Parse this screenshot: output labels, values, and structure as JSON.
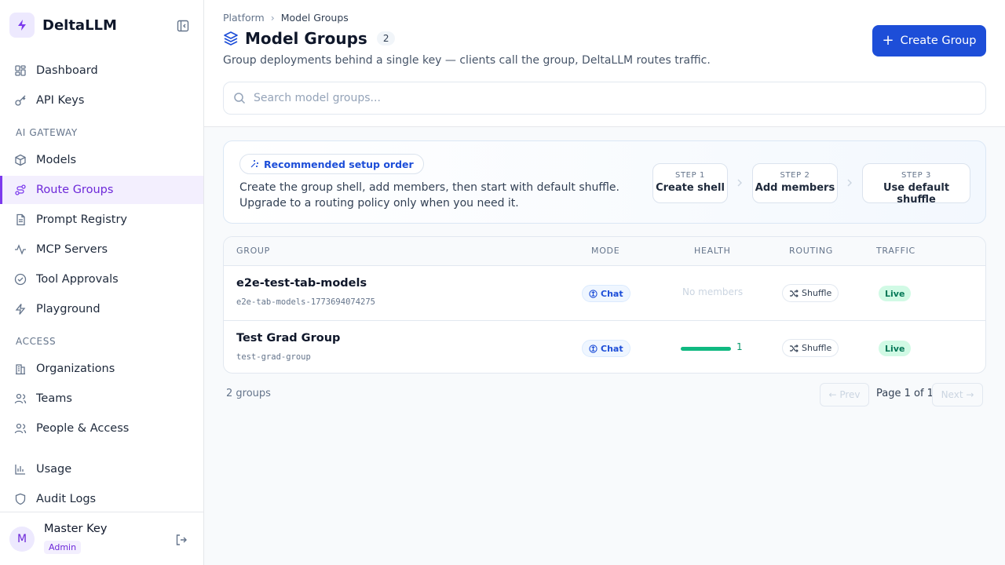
{
  "brand": {
    "name": "DeltaLLM",
    "accent": "#7c3aed"
  },
  "sidebar": {
    "items": [
      {
        "label": "Dashboard",
        "icon": "dashboard-icon"
      },
      {
        "label": "API Keys",
        "icon": "key-icon"
      },
      {
        "label": "Models",
        "icon": "cube-icon"
      },
      {
        "label": "Route Groups",
        "icon": "route-icon",
        "active": true
      },
      {
        "label": "Prompt Registry",
        "icon": "document-icon"
      },
      {
        "label": "MCP Servers",
        "icon": "activity-icon"
      },
      {
        "label": "Tool Approvals",
        "icon": "check-circle-icon"
      },
      {
        "label": "Playground",
        "icon": "bolt-icon"
      },
      {
        "label": "Organizations",
        "icon": "building-icon"
      },
      {
        "label": "Teams",
        "icon": "users-icon"
      },
      {
        "label": "People & Access",
        "icon": "people-icon"
      },
      {
        "label": "Usage",
        "icon": "bar-chart-icon"
      },
      {
        "label": "Audit Logs",
        "icon": "shield-icon"
      }
    ],
    "sections": {
      "gateway": "AI GATEWAY",
      "access": "ACCESS"
    }
  },
  "user": {
    "initial": "M",
    "name": "Master Key",
    "role": "Admin"
  },
  "header": {
    "breadcrumb": [
      "Platform",
      "Model Groups"
    ],
    "title": "Model Groups",
    "count": "2",
    "subtitle": "Group deployments behind a single key — clients call the group, DeltaLLM routes traffic.",
    "create_label": "Create Group",
    "search_placeholder": "Search model groups...",
    "primary_color": "#1d4ed8"
  },
  "setup": {
    "pill": "Recommended setup order",
    "text": "Create the group shell, add members, then start with default shuffle. Upgrade to a routing policy only when you need it.",
    "steps": [
      {
        "label": "STEP 1",
        "value": "Create shell"
      },
      {
        "label": "STEP 2",
        "value": "Add members"
      },
      {
        "label": "STEP 3",
        "value": "Use default shuffle"
      }
    ]
  },
  "table": {
    "columns": [
      "GROUP",
      "MODE",
      "HEALTH",
      "ROUTING",
      "TRAFFIC"
    ],
    "rows": [
      {
        "name": "e2e-test-tab-models",
        "slug": "e2e-tab-models-1773694074275",
        "mode": "Chat",
        "health": "No members",
        "routing": "Shuffle",
        "traffic": "Live"
      },
      {
        "name": "Test Grad Group",
        "slug": "test-grad-group",
        "mode": "Chat",
        "health": "1",
        "health_fraction": 1.0,
        "routing": "Shuffle",
        "traffic": "Live"
      }
    ]
  },
  "footer": {
    "total": "2 groups",
    "prev": "← Prev",
    "page": "Page 1 of 1",
    "next": "Next →"
  }
}
